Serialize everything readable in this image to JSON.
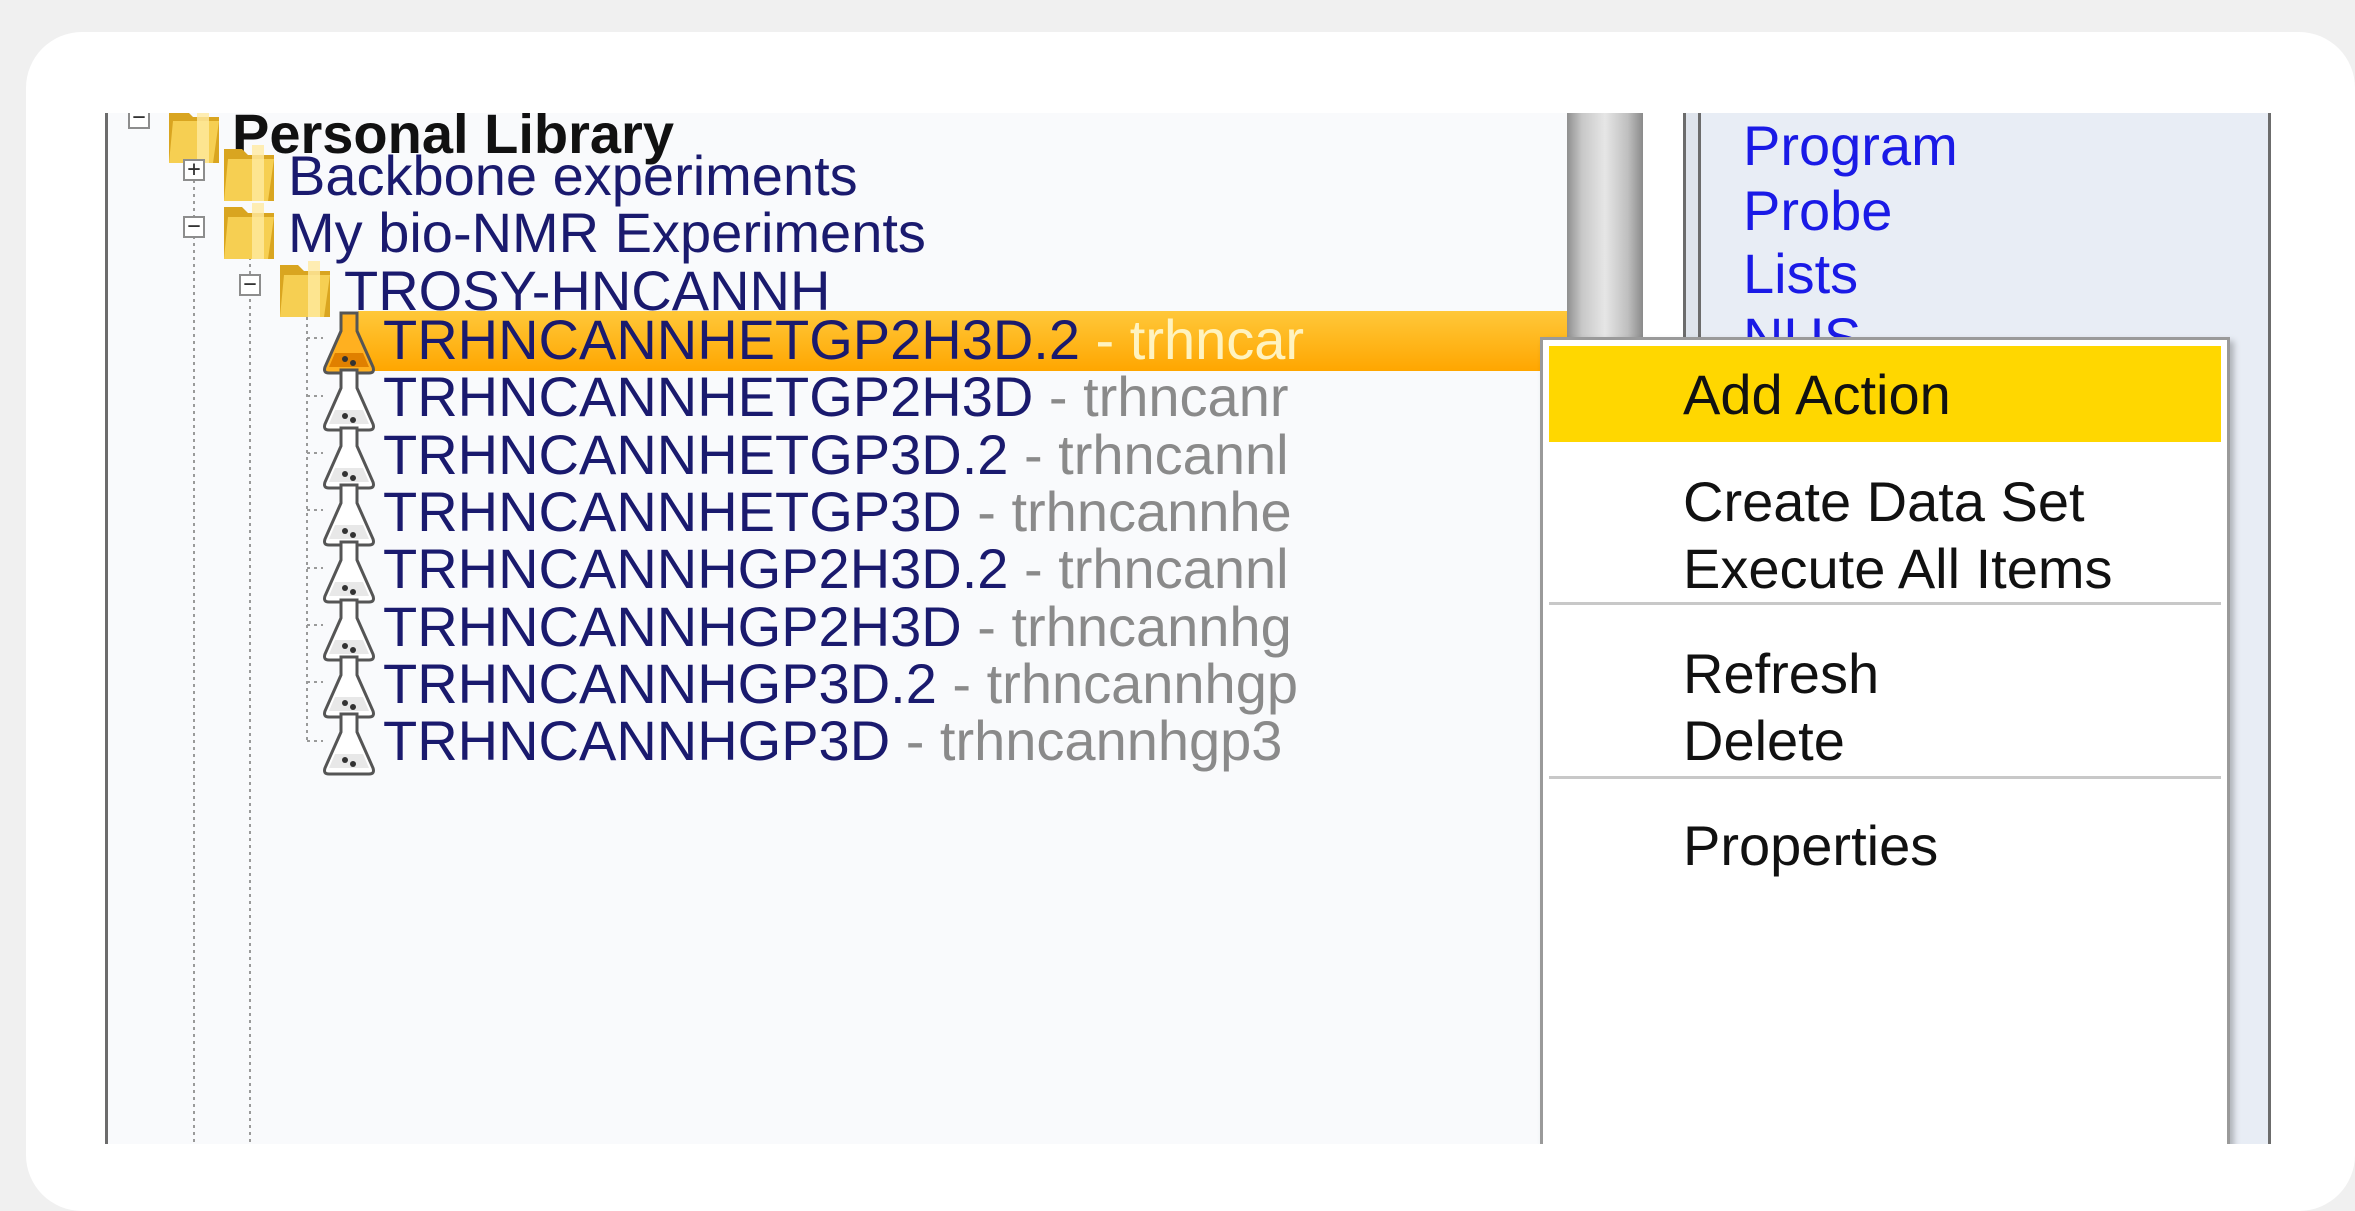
{
  "tree": {
    "root": {
      "label": "Personal Library"
    },
    "folders": [
      {
        "label": "Backbone experiments",
        "expander": "+"
      },
      {
        "label": "My bio-NMR Experiments",
        "expander": "−"
      },
      {
        "label": "TROSY-HNCANNH",
        "expander": "−"
      }
    ],
    "root_expander": "−",
    "experiments": [
      {
        "name": "TRHNCANNHETGP2H3D.2",
        "desc": " - trhncar"
      },
      {
        "name": "TRHNCANNHETGP2H3D",
        "desc": " - trhncanr"
      },
      {
        "name": "TRHNCANNHETGP3D.2",
        "desc": " - trhncannl"
      },
      {
        "name": "TRHNCANNHETGP3D",
        "desc": " - trhncannhe"
      },
      {
        "name": "TRHNCANNHGP2H3D.2",
        "desc": " - trhncannl"
      },
      {
        "name": "TRHNCANNHGP2H3D",
        "desc": " - trhncannhg"
      },
      {
        "name": "TRHNCANNHGP3D.2",
        "desc": " - trhncannhgp"
      },
      {
        "name": "TRHNCANNHGP3D",
        "desc": " - trhncannhgp3"
      }
    ],
    "selected_index": 0
  },
  "links": [
    "Program",
    "Probe",
    "Lists",
    "NUS"
  ],
  "context_menu": {
    "items": [
      {
        "label": "Add Action",
        "highlighted": true
      },
      {
        "label": "Create Data Set"
      },
      {
        "label": "Execute All Items"
      },
      {
        "label": "Refresh"
      },
      {
        "label": "Delete"
      },
      {
        "label": "Properties"
      }
    ]
  },
  "colors": {
    "selection": "#ffa600",
    "menu_highlight": "#ffd700",
    "link": "#1a1ae6",
    "tree_text": "#1a1a6e",
    "desc_text": "#8a8a8a"
  }
}
